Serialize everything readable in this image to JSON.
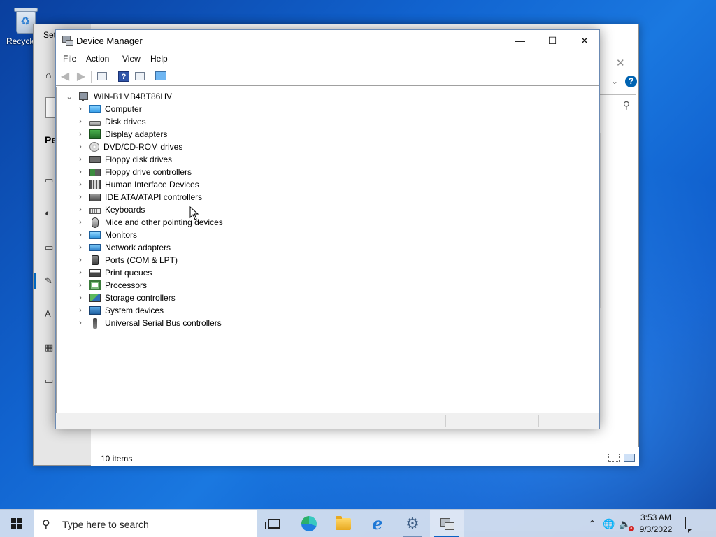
{
  "desktop": {
    "recycle_bin_label": "Recycle Bin"
  },
  "settings_window": {
    "title_partial": "Set",
    "heading_partial": "Pe",
    "status_count": "10 items"
  },
  "device_manager": {
    "title": "Device Manager",
    "menu": [
      "File",
      "Action",
      "View",
      "Help"
    ],
    "root": "WIN-B1MB4BT86HV",
    "categories": [
      {
        "label": "Computer",
        "icon": "computer-icon"
      },
      {
        "label": "Disk drives",
        "icon": "disk-drive-icon"
      },
      {
        "label": "Display adapters",
        "icon": "display-adapter-icon"
      },
      {
        "label": "DVD/CD-ROM drives",
        "icon": "dvd-drive-icon"
      },
      {
        "label": "Floppy disk drives",
        "icon": "floppy-disk-icon"
      },
      {
        "label": "Floppy drive controllers",
        "icon": "floppy-controller-icon"
      },
      {
        "label": "Human Interface Devices",
        "icon": "hid-icon"
      },
      {
        "label": "IDE ATA/ATAPI controllers",
        "icon": "ide-controller-icon"
      },
      {
        "label": "Keyboards",
        "icon": "keyboard-icon"
      },
      {
        "label": "Mice and other pointing devices",
        "icon": "mouse-icon"
      },
      {
        "label": "Monitors",
        "icon": "monitor-icon"
      },
      {
        "label": "Network adapters",
        "icon": "network-adapter-icon"
      },
      {
        "label": "Ports (COM & LPT)",
        "icon": "port-icon"
      },
      {
        "label": "Print queues",
        "icon": "printer-icon"
      },
      {
        "label": "Processors",
        "icon": "processor-icon"
      },
      {
        "label": "Storage controllers",
        "icon": "storage-controller-icon"
      },
      {
        "label": "System devices",
        "icon": "system-device-icon"
      },
      {
        "label": "Universal Serial Bus controllers",
        "icon": "usb-icon"
      }
    ]
  },
  "taskbar": {
    "search_placeholder": "Type here to search",
    "time": "3:53 AM",
    "date": "9/3/2022",
    "apps": [
      "task-view-icon",
      "edge-icon",
      "file-explorer-icon",
      "internet-explorer-icon",
      "settings-icon",
      "device-manager-icon"
    ]
  },
  "colors": {
    "accent": "#0067c0",
    "desktop": "#1163cf"
  }
}
